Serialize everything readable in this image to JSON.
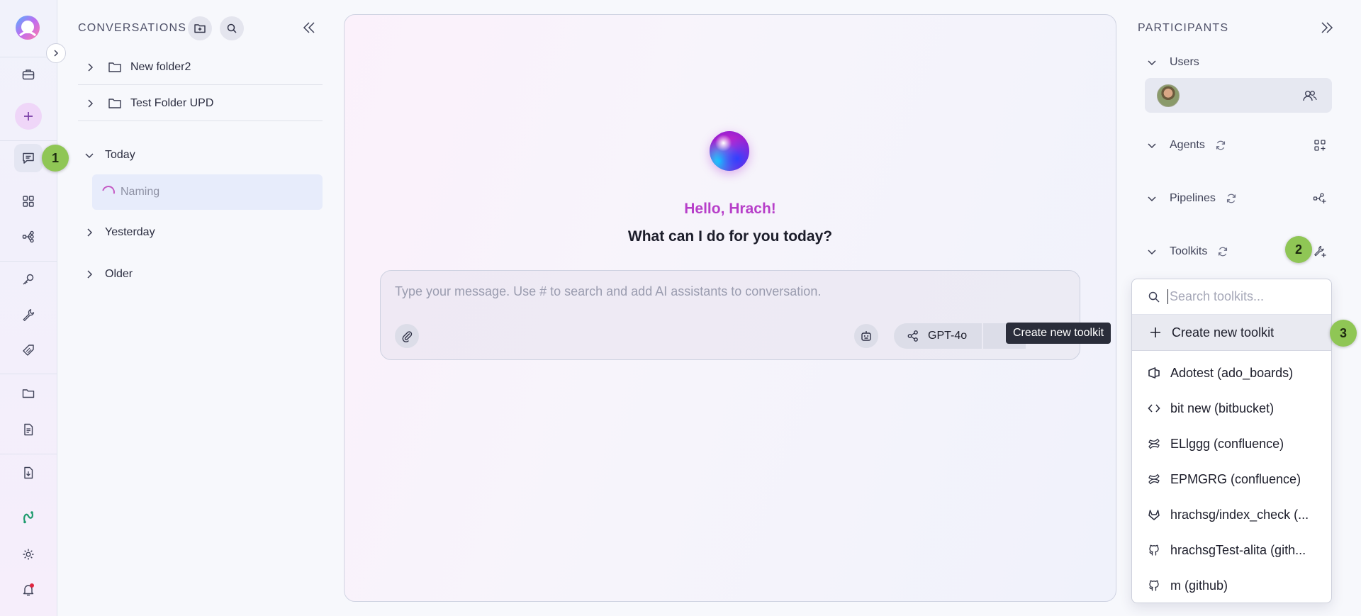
{
  "rail": {
    "items": [
      "app-logo",
      "briefcase-icon",
      "add-icon",
      "chat-icon",
      "grid-icon",
      "pipeline-icon",
      "key-icon",
      "wrench-icon",
      "tag-icon",
      "folder-icon",
      "document-icon",
      "download-icon",
      "link-icon",
      "gear-icon",
      "bell-icon"
    ],
    "notification_dot_color": "#e0243f"
  },
  "badges": {
    "one": "1",
    "two": "2",
    "three": "3"
  },
  "conversations": {
    "title": "CONVERSATIONS",
    "folders": [
      {
        "name": "New folder2"
      },
      {
        "name": "Test Folder UPD"
      }
    ],
    "groups": {
      "today": "Today",
      "yesterday": "Yesterday",
      "older": "Older"
    },
    "today_items": [
      {
        "name": "Naming",
        "status": "loading"
      }
    ]
  },
  "main": {
    "greeting": "Hello, Hrach!",
    "question": "What can I do for you today?",
    "composer_placeholder": "Type your message. Use # to search and add AI assistants to conversation.",
    "model": "GPT-4o",
    "tooltip": "Create new toolkit"
  },
  "participants": {
    "title": "PARTICIPANTS",
    "sections": {
      "users": "Users",
      "agents": "Agents",
      "pipelines": "Pipelines",
      "toolkits": "Toolkits"
    }
  },
  "toolkit_dropdown": {
    "search_placeholder": "Search toolkits...",
    "create_label": "Create new toolkit",
    "items": [
      {
        "label": "Adotest (ado_boards)",
        "icon": "azure-devops-icon"
      },
      {
        "label": "bit new (bitbucket)",
        "icon": "code-brackets-icon"
      },
      {
        "label": "ELlggg (confluence)",
        "icon": "confluence-icon"
      },
      {
        "label": "EPMGRG (confluence)",
        "icon": "confluence-icon"
      },
      {
        "label": "hrachsg/index_check (...",
        "icon": "gitlab-icon"
      },
      {
        "label": "hrachsgTest-alita (gith...",
        "icon": "github-icon"
      },
      {
        "label": "m (github)",
        "icon": "github-icon"
      }
    ]
  },
  "colors": {
    "accent": "#b73fc9",
    "badge": "#8fc655",
    "tooltip_bg": "#2a2d3a"
  }
}
